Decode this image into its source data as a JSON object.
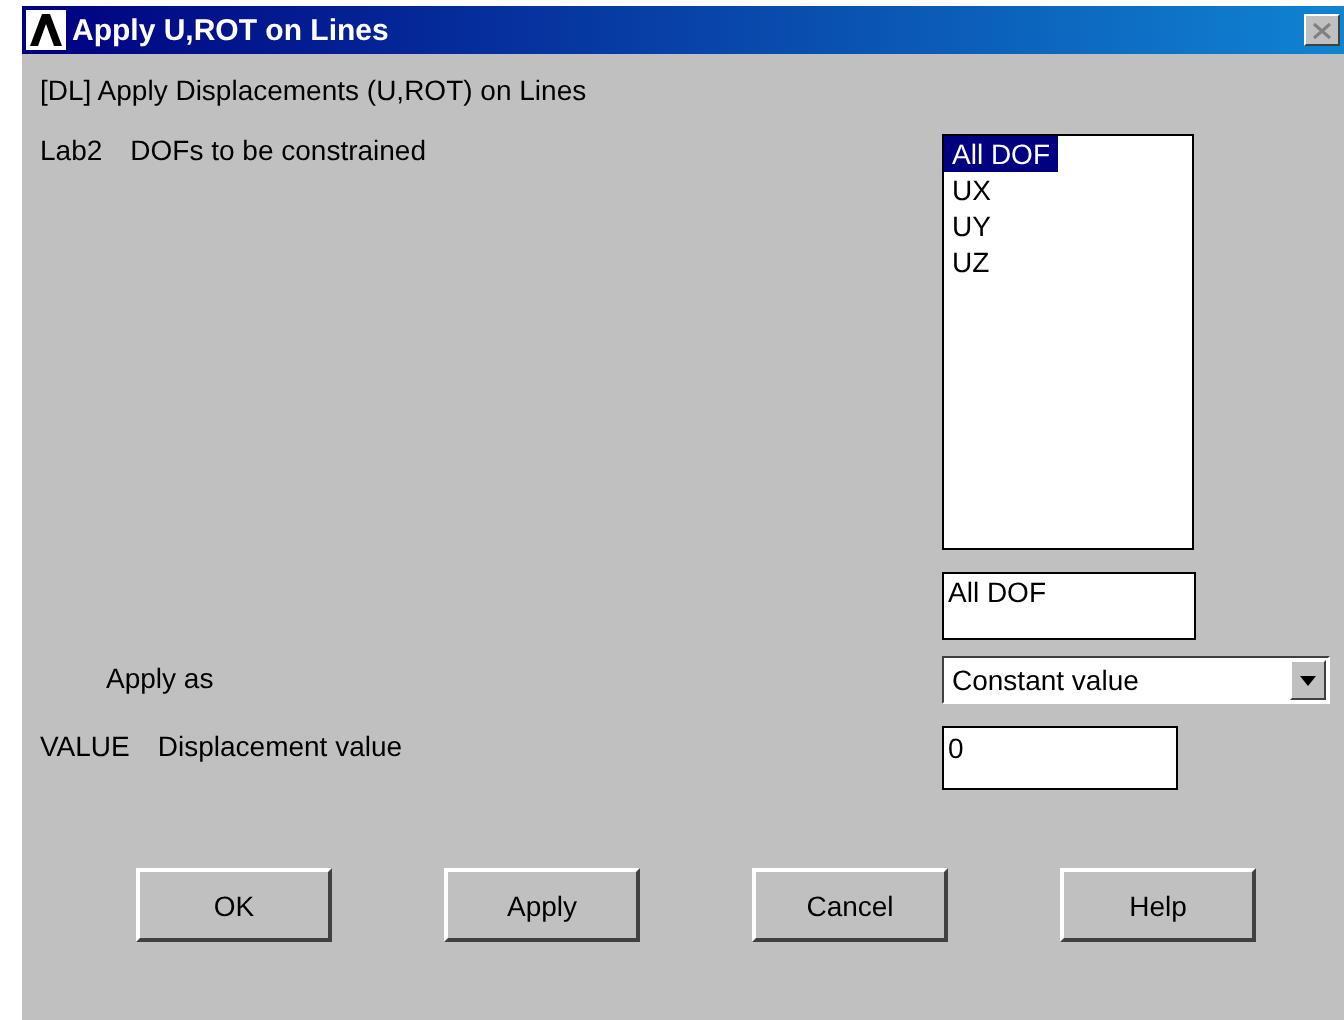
{
  "window": {
    "title": "Apply U,ROT on Lines"
  },
  "header": "[DL] Apply Displacements (U,ROT) on Lines",
  "fields": [
    {
      "kind": "listbox",
      "code": "Lab2",
      "label": "DOFs to be constrained",
      "options": [
        {
          "label": "All DOF",
          "selected": true
        },
        {
          "label": "UX",
          "selected": false
        },
        {
          "label": "UY",
          "selected": false
        },
        {
          "label": "UZ",
          "selected": false
        }
      ],
      "selection": "All DOF"
    },
    {
      "kind": "dropdown",
      "label": "Apply as",
      "value": "Constant value"
    },
    {
      "kind": "text",
      "code": "VALUE",
      "label": "Displacement value",
      "value": "0"
    }
  ],
  "buttons": [
    "OK",
    "Apply",
    "Cancel",
    "Help"
  ]
}
